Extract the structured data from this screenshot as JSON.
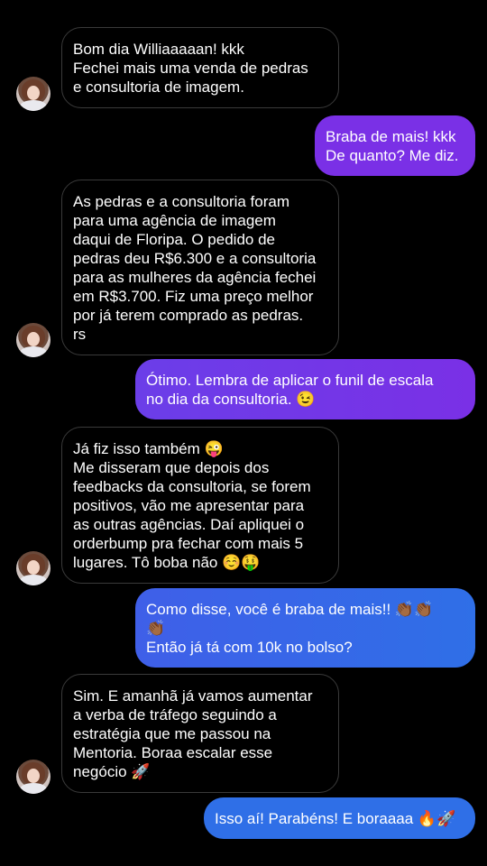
{
  "colors": {
    "background": "#000000",
    "incoming_border": "#3a3a3a",
    "outgoing_purple": "#7a30e6",
    "outgoing_blue": "#2f6fe7"
  },
  "messages": [
    {
      "dir": "in",
      "lines": [
        "Bom dia Williaaaaan! kkk",
        "Fechei mais uma venda de pedras",
        "e consultoria de imagem."
      ]
    },
    {
      "dir": "out",
      "lines": [
        "Braba de mais! kkk",
        "De quanto? Me diz."
      ]
    },
    {
      "dir": "in",
      "lines": [
        "As pedras e a consultoria foram",
        "para uma agência de imagem",
        "daqui de Floripa. O pedido de",
        "pedras deu R$6.300 e a consultoria",
        "para as mulheres da agência fechei",
        "em R$3.700. Fiz uma preço melhor",
        "por já terem comprado as pedras.",
        "rs"
      ]
    },
    {
      "dir": "out",
      "lines": [
        "Ótimo. Lembra de aplicar o funil de escala",
        "no dia da consultoria. 😉"
      ]
    },
    {
      "dir": "in",
      "lines": [
        "Já fiz isso também 😜",
        "Me disseram que depois dos",
        "feedbacks da consultoria, se forem",
        "positivos, vão me apresentar para",
        "as outras agências. Daí apliquei o",
        "orderbump pra fechar com mais 5",
        "lugares. Tô boba não ☺️🤑"
      ]
    },
    {
      "dir": "out",
      "lines": [
        "Como disse, você é braba de mais!! 👏🏾👏🏾",
        "👏🏾",
        "Então já tá com 10k no bolso?"
      ]
    },
    {
      "dir": "in",
      "lines": [
        "Sim. E amanhã já vamos aumentar",
        "a verba de tráfego seguindo a",
        "estratégia que me passou na",
        "Mentoria. Boraa escalar esse",
        "negócio 🚀"
      ]
    },
    {
      "dir": "out",
      "lines": [
        "Isso aí! Parabéns! E boraaaa 🔥🚀"
      ]
    }
  ]
}
